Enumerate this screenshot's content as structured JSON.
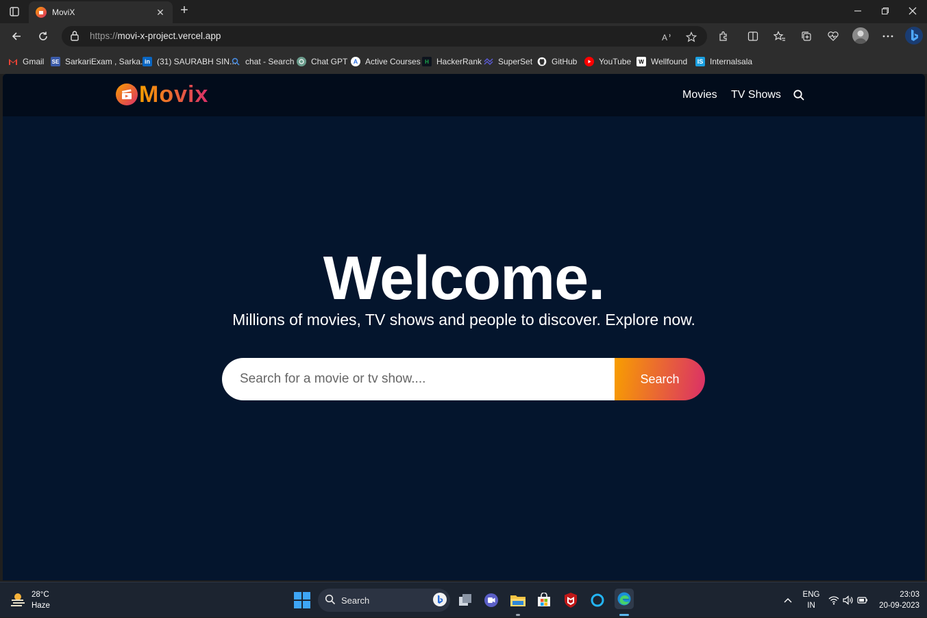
{
  "browser": {
    "tab_title": "MoviX",
    "url_scheme": "https://",
    "url_host": "movi-x-project.vercel.app",
    "bookmarks": [
      {
        "label": "Gmail",
        "icon": "gmail-icon",
        "color": "#ea4335"
      },
      {
        "label": "SarkariExam , Sarka...",
        "icon": "sarkariexam-icon",
        "color": "#3b5ba9"
      },
      {
        "label": "(31) SAURABH SIN...",
        "icon": "linkedin-icon",
        "color": "#0a66c2"
      },
      {
        "label": "chat - Search",
        "icon": "search-icon",
        "color": "#4a8fe7"
      },
      {
        "label": "Chat GPT",
        "icon": "chatgpt-icon",
        "color": "#6b9c8c"
      },
      {
        "label": "Active Courses",
        "icon": "courses-icon",
        "color": "#2f6fe0"
      },
      {
        "label": "HackerRank",
        "icon": "hackerrank-icon",
        "color": "#1ba94c"
      },
      {
        "label": "SuperSet",
        "icon": "superset-icon",
        "color": "#5b5bd6"
      },
      {
        "label": "GitHub",
        "icon": "github-icon",
        "color": "#ffffff"
      },
      {
        "label": "YouTube",
        "icon": "youtube-icon",
        "color": "#ff0000"
      },
      {
        "label": "Wellfound",
        "icon": "wellfound-icon",
        "color": "#ffffff"
      },
      {
        "label": "Internalsala",
        "icon": "internshala-icon",
        "color": "#1a9fe0"
      }
    ]
  },
  "site": {
    "logo_text": "Movix",
    "nav": {
      "movies": "Movies",
      "tv_shows": "TV Shows"
    },
    "hero": {
      "title": "Welcome.",
      "subtitle": "Millions of movies, TV shows and people to discover. Explore now.",
      "search_placeholder": "Search for a movie or tv show....",
      "search_button": "Search"
    },
    "colors": {
      "accent_start": "#f89e00",
      "accent_end": "#da2f68",
      "background": "#04152d",
      "header": "#020c1b"
    }
  },
  "taskbar": {
    "weather_temp": "28°C",
    "weather_desc": "Haze",
    "search_label": "Search",
    "lang_top": "ENG",
    "lang_bottom": "IN",
    "time": "23:03",
    "date": "20-09-2023"
  }
}
